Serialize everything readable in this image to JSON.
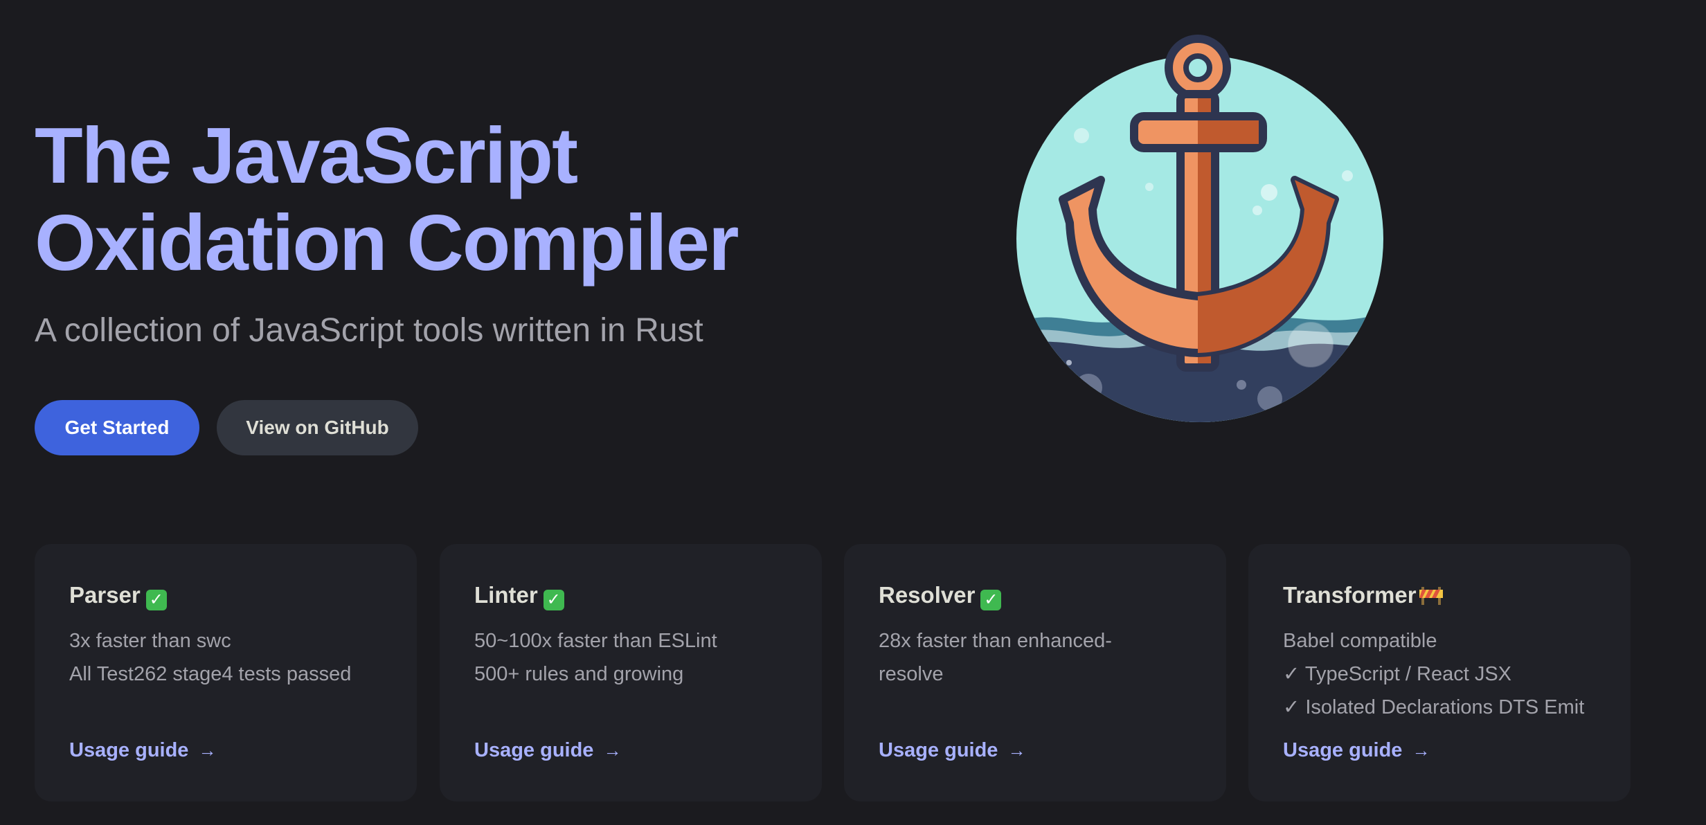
{
  "hero": {
    "title_line1": "The JavaScript",
    "title_line2": "Oxidation Compiler",
    "tagline": "A collection of JavaScript tools written in Rust",
    "primary_button": "Get Started",
    "secondary_button": "View on GitHub",
    "image": "anchor-logo-icon"
  },
  "colors": {
    "background": "#1b1b1f",
    "brand": "#a8b1ff",
    "primary_button": "#3e63dd",
    "card_background": "#202127"
  },
  "features": [
    {
      "title": "Parser",
      "badge_icon": "check-mark-icon",
      "lines": [
        "3x faster than swc",
        "All Test262 stage4 tests passed"
      ],
      "link": "Usage guide"
    },
    {
      "title": "Linter",
      "badge_icon": "check-mark-icon",
      "lines": [
        "50~100x faster than ESLint",
        "500+ rules and growing"
      ],
      "link": "Usage guide"
    },
    {
      "title": "Resolver",
      "badge_icon": "check-mark-icon",
      "lines": [
        "28x faster than enhanced-",
        "resolve"
      ],
      "link": "Usage guide"
    },
    {
      "title": "Transformer",
      "badge_icon": "construction-barrier-icon",
      "lines": [
        "Babel compatible",
        "✓ TypeScript / React JSX",
        "✓ Isolated Declarations DTS Emit"
      ],
      "link": "Usage guide"
    }
  ]
}
